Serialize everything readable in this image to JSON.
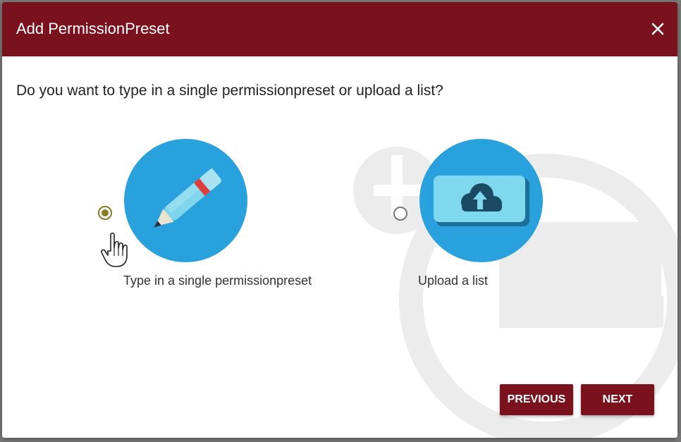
{
  "dialog": {
    "title": "Add PermissionPreset",
    "close_icon": "close-icon",
    "question": "Do you want to type in a single permissionpreset or upload a list?"
  },
  "options": [
    {
      "label": "Type in a single permissionpreset",
      "icon": "pencil-icon",
      "selected": true
    },
    {
      "label": "Upload a list",
      "icon": "cloud-upload-icon",
      "selected": false
    }
  ],
  "buttons": {
    "previous": "PREVIOUS",
    "next": "NEXT"
  },
  "colors": {
    "header": "#79121c",
    "accent_circle": "#29a1dc",
    "radio_selected": "#8a7a26",
    "button": "#79121c"
  }
}
